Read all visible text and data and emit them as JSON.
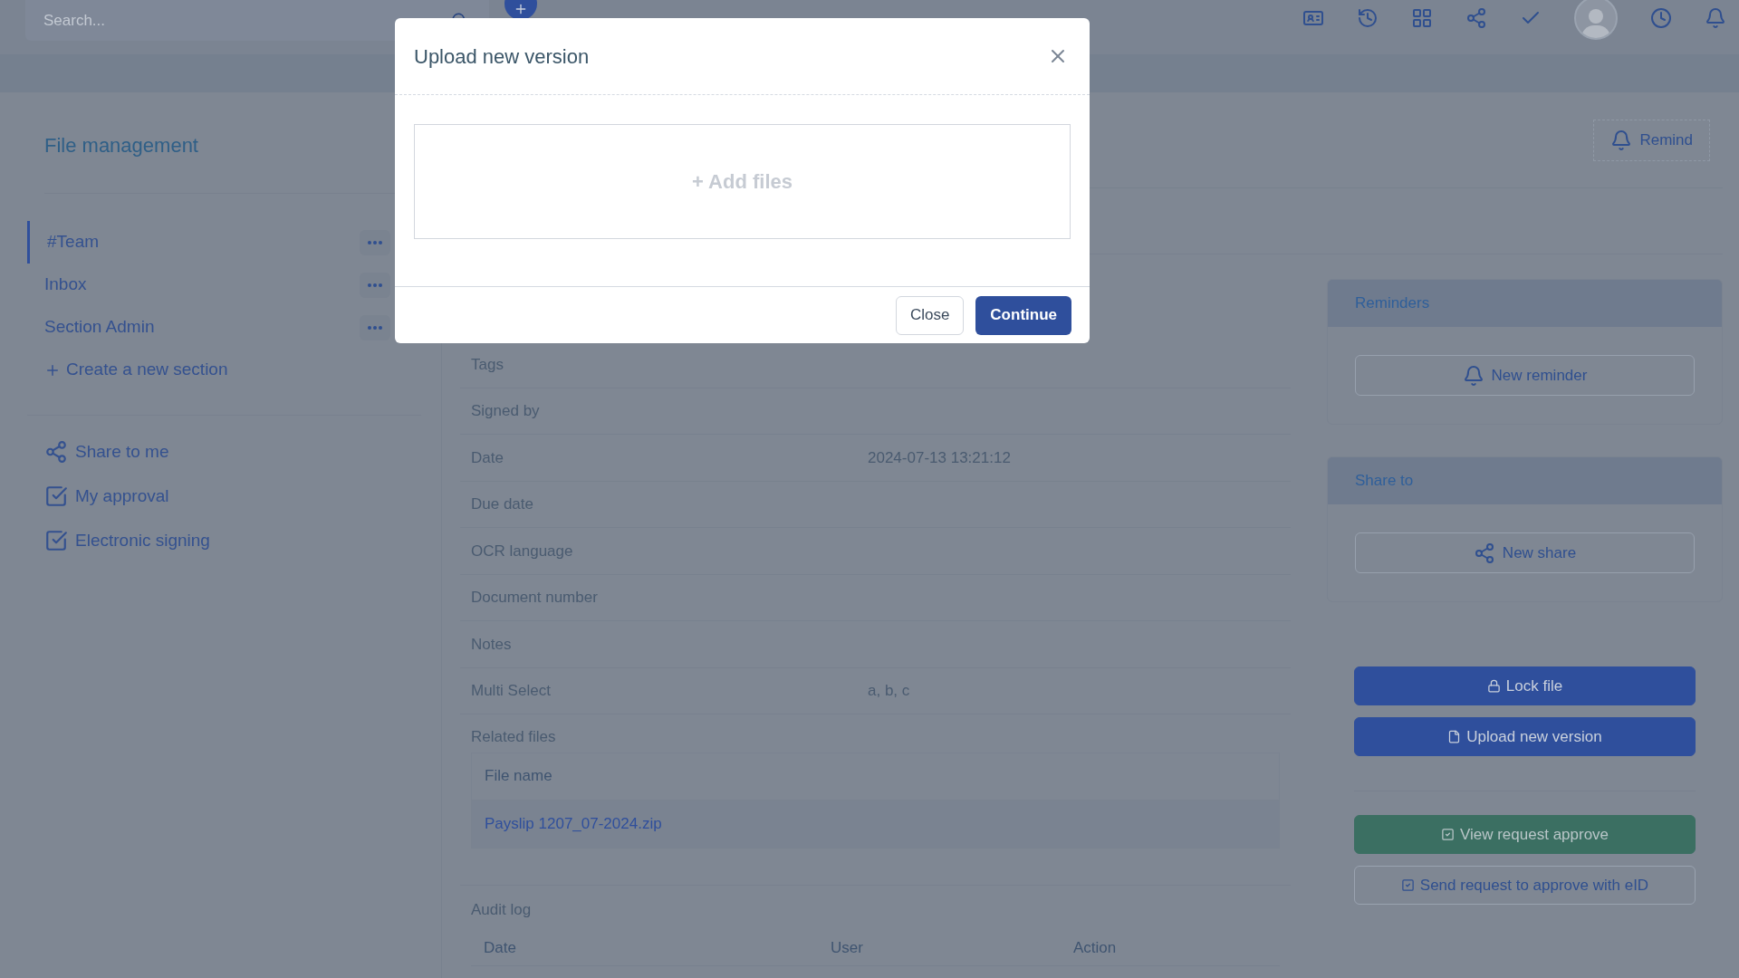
{
  "top_bar": {
    "search": {
      "placeholder": "Search..."
    }
  },
  "sidebar": {
    "title": "File management",
    "sections": [
      {
        "label": "#Team",
        "selected": true
      },
      {
        "label": "Inbox",
        "selected": false
      },
      {
        "label": "Section Admin",
        "selected": false
      }
    ],
    "create_section": "Create a new section",
    "links": [
      {
        "label": "Share to me",
        "kind": "share"
      },
      {
        "label": "My approval",
        "kind": "check"
      },
      {
        "label": "Electronic signing",
        "kind": "check"
      }
    ]
  },
  "header": {
    "remind": "Remind"
  },
  "details": {
    "fields": [
      {
        "label": "Tags"
      },
      {
        "label": "Signed by"
      },
      {
        "label": "Date",
        "value": "2024-07-13 13:21:12"
      },
      {
        "label": "Due date"
      },
      {
        "label": "OCR language"
      },
      {
        "label": "Document number"
      },
      {
        "label": "Notes"
      },
      {
        "label": "Multi Select",
        "value": "a, b, c"
      }
    ],
    "related_files": {
      "title": "Related files",
      "columns": [
        "File name"
      ],
      "rows": [
        "Payslip 1207_07-2024.zip"
      ]
    },
    "audit_log": {
      "title": "Audit log",
      "columns": [
        "Date",
        "User",
        "Action"
      ]
    }
  },
  "right_panel": {
    "cards": [
      {
        "title": "Reminders",
        "button": "New reminder",
        "kind": "bell"
      },
      {
        "title": "Share to",
        "button": "New share",
        "kind": "share"
      }
    ],
    "action_groups": [
      [
        {
          "label": "Lock file",
          "kind": "lock"
        },
        {
          "label": "Upload new version",
          "kind": "upload"
        }
      ],
      [
        {
          "label": "View request approve",
          "kind": "approve"
        },
        {
          "label": "Send request to approve with eID",
          "kind": "request"
        }
      ]
    ]
  },
  "modal": {
    "title": "Upload new version",
    "dropzone": "+ Add files",
    "buttons": [
      {
        "label": "Close",
        "kind": "secondary"
      },
      {
        "label": "Continue",
        "kind": "primary"
      }
    ]
  }
}
